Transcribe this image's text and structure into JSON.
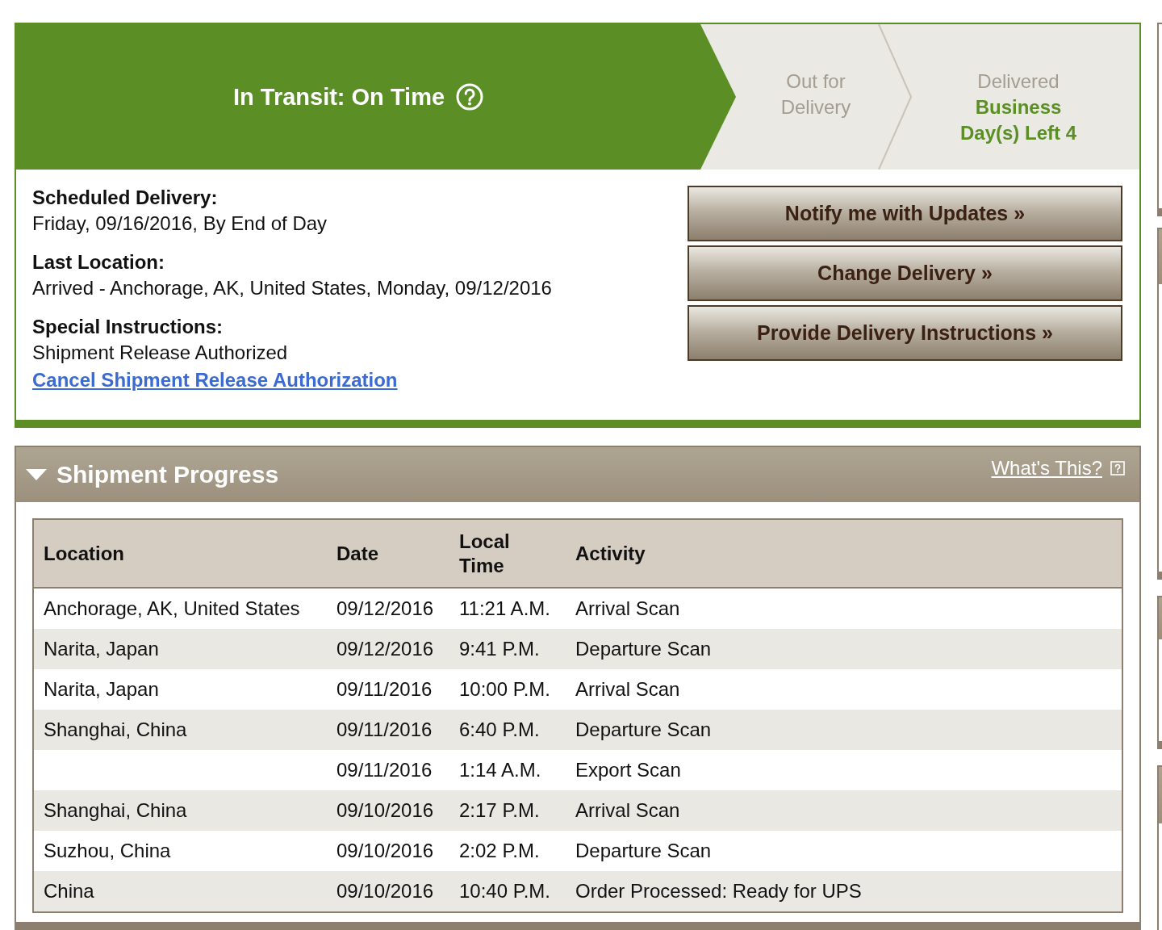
{
  "tracker": {
    "steps": [
      {
        "label": "In Transit: On Time",
        "selected": true
      },
      {
        "label": "Out for Delivery",
        "selected": false
      },
      {
        "label": "Delivered",
        "note": "Business Day(s) Left 4",
        "selected": false
      }
    ]
  },
  "details": [
    {
      "label": "Scheduled Delivery:",
      "value": "Friday, 09/16/2016, By End of Day"
    },
    {
      "label": "Last Location:",
      "value": "Arrived - Anchorage, AK, United States, Monday, 09/12/2016"
    },
    {
      "label": "Special Instructions:",
      "value": "Shipment Release Authorized",
      "link": "Cancel Shipment Release Authorization"
    }
  ],
  "actions": [
    "Notify me with Updates »",
    "Change Delivery »",
    "Provide Delivery Instructions »"
  ],
  "shipment_progress": {
    "title": "Shipment Progress",
    "expanded": true,
    "help_link": "What's This?",
    "table": {
      "columns": [
        "Location",
        "Date",
        "Local Time",
        "Activity"
      ],
      "rows": [
        {
          "location": "Anchorage, AK, United States",
          "date": "09/12/2016",
          "time": "11:21 A.M.",
          "activity": "Arrival Scan"
        },
        {
          "location": "Narita, Japan",
          "date": "09/12/2016",
          "time": "9:41 P.M.",
          "activity": "Departure Scan"
        },
        {
          "location": "Narita, Japan",
          "date": "09/11/2016",
          "time": "10:00 P.M.",
          "activity": "Arrival Scan"
        },
        {
          "location": "Shanghai, China",
          "date": "09/11/2016",
          "time": "6:40 P.M.",
          "activity": "Departure Scan"
        },
        {
          "date": "09/11/2016",
          "time": "1:14 A.M.",
          "activity": "Export Scan"
        },
        {
          "location": "Shanghai, China",
          "date": "09/10/2016",
          "time": "2:17 P.M.",
          "activity": "Arrival Scan"
        },
        {
          "location": "Suzhou, China",
          "date": "09/10/2016",
          "time": "2:02 P.M.",
          "activity": "Departure Scan"
        },
        {
          "location": "China",
          "date": "09/10/2016",
          "time": "10:40 P.M.",
          "activity": "Order Processed: Ready for UPS"
        }
      ]
    }
  }
}
